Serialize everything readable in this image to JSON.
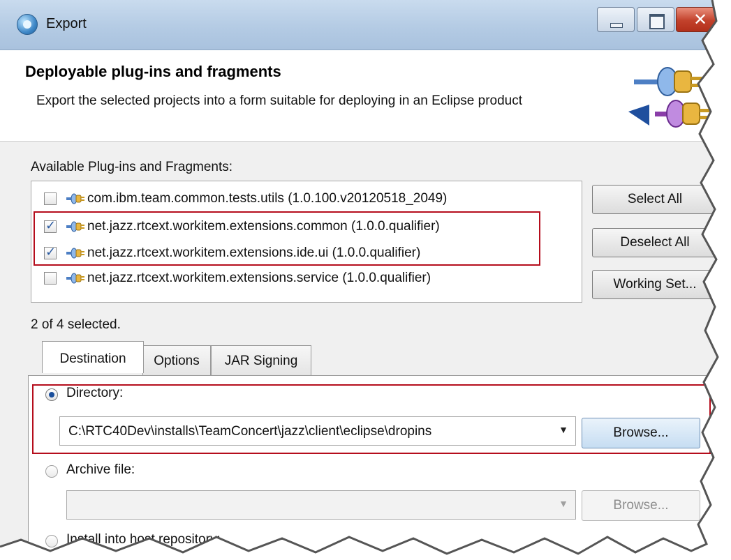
{
  "window": {
    "title": "Export"
  },
  "header": {
    "title": "Deployable plug-ins and fragments",
    "description": "Export the selected projects into a form suitable for deploying in an Eclipse product"
  },
  "plugins": {
    "label": "Available Plug-ins and Fragments:",
    "items": [
      {
        "label": "com.ibm.team.common.tests.utils (1.0.100.v20120518_2049)",
        "checked": false
      },
      {
        "label": "net.jazz.rtcext.workitem.extensions.common (1.0.0.qualifier)",
        "checked": true
      },
      {
        "label": "net.jazz.rtcext.workitem.extensions.ide.ui (1.0.0.qualifier)",
        "checked": true
      },
      {
        "label": "net.jazz.rtcext.workitem.extensions.service (1.0.0.qualifier)",
        "checked": false
      }
    ],
    "select_all": "Select All",
    "deselect_all": "Deselect All",
    "working_set": "Working Set...",
    "status": "2 of 4 selected."
  },
  "tabs": [
    {
      "label": "Destination",
      "active": true
    },
    {
      "label": "Options",
      "active": false
    },
    {
      "label": "JAR Signing",
      "active": false
    }
  ],
  "destination": {
    "directory_label": "Directory:",
    "directory_value": "C:\\RTC40Dev\\installs\\TeamConcert\\jazz\\client\\eclipse\\dropins",
    "browse_label": "Browse...",
    "archive_label": "Archive file:",
    "archive_value": "",
    "archive_browse_label": "Browse...",
    "install_label": "Install into host repository:"
  },
  "colors": {
    "highlight": "#b50d1c",
    "titlebar": "#b4cbe4",
    "close_button": "#c2412b"
  }
}
